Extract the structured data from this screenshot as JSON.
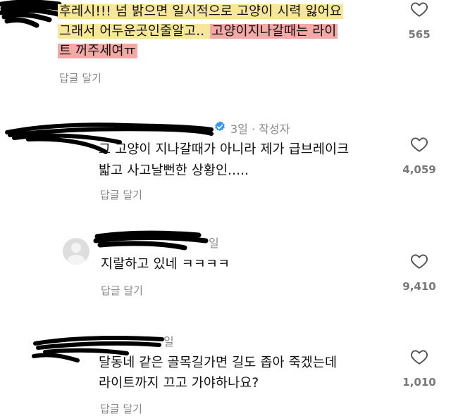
{
  "comments": [
    {
      "id": "c1",
      "lines": [
        {
          "plain": "후레시!!! 넘 밝으면 일시적으로 고양이 시력 잃어요",
          "highlight": "yellow"
        },
        {
          "part1": "그래서 어두운곳인줄알고.. ",
          "part1_hl": "yellow",
          "part2": "고양이지나갈때는 라이",
          "part2_hl": "pink"
        },
        {
          "plain": "트 꺼주세여ㅠ",
          "highlight": "pink"
        }
      ],
      "reply_label": "답글 달기",
      "likes": "565"
    },
    {
      "id": "c2",
      "meta": "3일 · 작성자",
      "verified": true,
      "lines": [
        "그 고양이 지나갈때가 아니라 제가 급브레이크",
        "밟고 사고날뻔한 상황인....."
      ],
      "reply_label": "답글 달기",
      "likes": "4,059"
    },
    {
      "id": "c3",
      "meta_suffix": "일",
      "lines": [
        "지랄하고 있네 ㅋㅋㅋㅋ"
      ],
      "reply_label": "답글 달기",
      "likes": "9,410"
    },
    {
      "id": "c4",
      "meta_suffix": "일",
      "lines": [
        "달동네 같은 골목길가면 길도 좁아 죽겠는데",
        "라이트까지 끄고 가야하나요?"
      ],
      "reply_label": "답글 달기",
      "likes": "1,010"
    }
  ],
  "icons": {
    "like": "heart-outline-icon",
    "verified": "verified-badge-icon",
    "avatar": "default-avatar-icon"
  },
  "colors": {
    "highlight_yellow": "#f7e79a",
    "highlight_pink": "#f3a9a6",
    "verified_blue": "#3897f0",
    "muted_text": "#8a8a8a",
    "redaction": "#000000"
  }
}
